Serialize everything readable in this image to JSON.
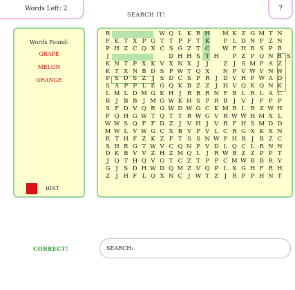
{
  "header": {
    "words_left": "Words Left: 2",
    "title": "SEARCH IT!",
    "help_label": "?"
  },
  "sidebar": {
    "found_heading": "Words Found:",
    "found_words": [
      "GRAPE",
      "MELON",
      "ORANGE"
    ],
    "hint_label": "HINT",
    "hint_color": "#dd1111"
  },
  "grid": {
    "rows": [
      "B     WQLKRH MKZGMTN",
      "FKTXPGTTPFTK PLDNPZN",
      "PHZCQXCSGZTC WFHRSPB",
      "J      DHHSTH PZPQNBS",
      "KNTPXKVXNXJJ ZJSMFAZ",
      "KTXNBDSPWTQX NPVWVNW",
      "PSDSZJSDCSPRJDVHPWAD",
      "SAPPLEGQKBZZJHVQKQNK",
      "LMLDMGKHJRRRNFBLRLAC",
      "BJBBJMGWKHSPRBJVJFPP",
      "SFDVQRGWDWGCKMBLBZWH",
      "FQHGWTQTTRWGVRWWHMXL",
      "WWSQFFDZJVHJVRFHSMDD",
      "MWLVWGCXBVPVLCRGXKXN",
      "RTHFZKZFTSSNWPHBJBZC",
      "SHRGTWVCQNPVDLQCLRNN",
      "DKBVVZHZMQLJRWBZZPPT",
      "JQTHQVGTCZTPPCMWBBRV",
      "GJSDHWDQMZVQPLXGHFRH",
      "ZJHFLQXNCJWTZJRPPHNT"
    ]
  },
  "status": {
    "result": "CORRECT!"
  },
  "search": {
    "label": "SEARCH:",
    "value": ""
  }
}
